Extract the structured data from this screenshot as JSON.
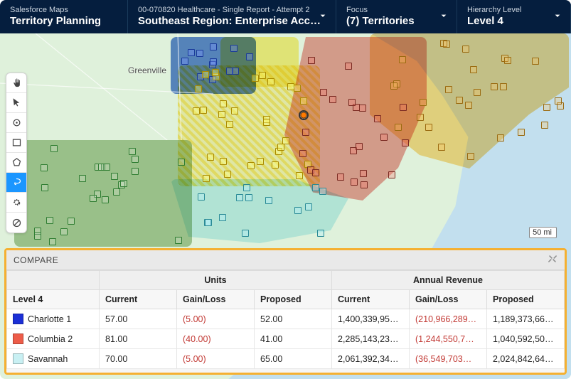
{
  "header": {
    "brand_small": "Salesforce Maps",
    "brand_big": "Territory Planning",
    "record_small": "00-070820 Healthcare - Single Report - Attempt 2",
    "record_big": "Southeast Region: Enterprise Accounts",
    "focus_small": "Focus",
    "focus_big": "(7) Territories",
    "level_small": "Hierarchy Level",
    "level_big": "Level 4"
  },
  "map": {
    "city_label": "Greenville",
    "scale_label": "50 mi"
  },
  "toolbar": {
    "items": [
      {
        "name": "hand-tool",
        "icon": "hand"
      },
      {
        "name": "pointer-tool",
        "icon": "pointer"
      },
      {
        "name": "circle-select-tool",
        "icon": "circle"
      },
      {
        "name": "rect-select-tool",
        "icon": "rect"
      },
      {
        "name": "poly-select-tool",
        "icon": "poly"
      },
      {
        "name": "lasso-tool",
        "icon": "lasso",
        "active": true
      },
      {
        "name": "settings-tool",
        "icon": "gear"
      },
      {
        "name": "no-tool",
        "icon": "nope"
      }
    ]
  },
  "compare": {
    "title": "COMPARE",
    "groups": {
      "units": "Units",
      "revenue": "Annual Revenue"
    },
    "columns": {
      "level": "Level 4",
      "u_current": "Current",
      "u_gainloss": "Gain/Loss",
      "u_proposed": "Proposed",
      "r_current": "Current",
      "r_gainloss": "Gain/Loss",
      "r_proposed": "Proposed"
    },
    "rows": [
      {
        "name": "Charlotte 1",
        "color": "#1b2fd6",
        "u_current": "57.00",
        "u_gainloss": "(5.00)",
        "u_proposed": "52.00",
        "r_current": "1,400,339,95…",
        "r_gainloss": "(210,966,289…",
        "r_proposed": "1,189,373,66…"
      },
      {
        "name": "Columbia 2",
        "color": "#ed5c49",
        "u_current": "81.00",
        "u_gainloss": "(40.00)",
        "u_proposed": "41.00",
        "r_current": "2,285,143,23…",
        "r_gainloss": "(1,244,550,7…",
        "r_proposed": "1,040,592,50…"
      },
      {
        "name": "Savannah",
        "color": "#c9f0f3",
        "u_current": "70.00",
        "u_gainloss": "(5.00)",
        "u_proposed": "65.00",
        "r_current": "2,061,392,34…",
        "r_gainloss": "(36,549,703…",
        "r_proposed": "2,024,842,64…"
      }
    ]
  }
}
